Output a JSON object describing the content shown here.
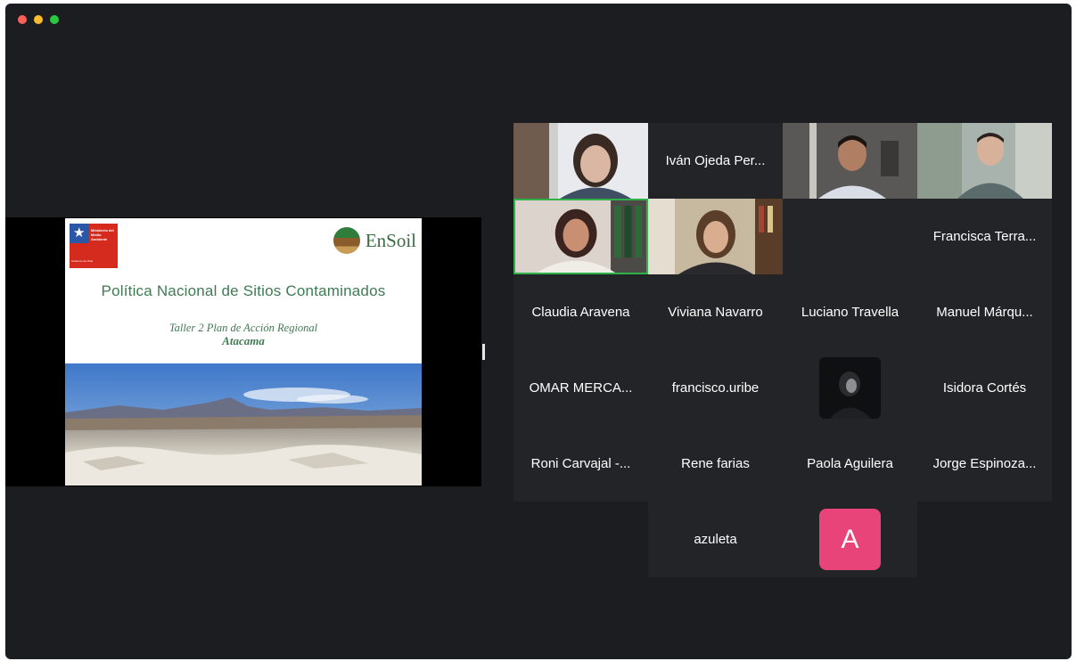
{
  "window": {
    "traffic_lights": {
      "close": "#fe5f57",
      "minimize": "#febc2e",
      "maximize": "#28c840"
    }
  },
  "shared_screen": {
    "slide": {
      "gov_logo_text": "Ministerio del Medio Ambiente",
      "gov_logo_subtext": "Gobierno de Chile",
      "brand": "EnSoil",
      "title": "Política Nacional de Sitios Contaminados",
      "subtitle": "Taller 2 Plan de Acción Regional",
      "region": "Atacama"
    }
  },
  "gallery": {
    "row1": [
      {
        "type": "video",
        "name": ""
      },
      {
        "type": "name",
        "name": "Iván Ojeda Per..."
      },
      {
        "type": "video",
        "name": ""
      },
      {
        "type": "video",
        "name": ""
      }
    ],
    "row2": [
      {
        "type": "video",
        "name": "",
        "active": true
      },
      {
        "type": "video",
        "name": ""
      },
      {
        "type": "empty",
        "name": ""
      },
      {
        "type": "name",
        "name": "Francisca Terra..."
      }
    ],
    "row3": [
      "Claudia Aravena",
      "Viviana Navarro",
      "Luciano Travella",
      "Manuel Márqu..."
    ],
    "row4": [
      "OMAR MERCA...",
      "francisco.uribe",
      "",
      "Isidora Cortés"
    ],
    "row5": [
      "Roni Carvajal -...",
      "Rene farias",
      "Paola Aguilera",
      "Jorge Espinoza..."
    ],
    "row6": [
      "azuleta",
      ""
    ],
    "avatar_letter": "A",
    "avatar_color": "#e8447a",
    "active_speaker_color": "#2fb24a"
  }
}
